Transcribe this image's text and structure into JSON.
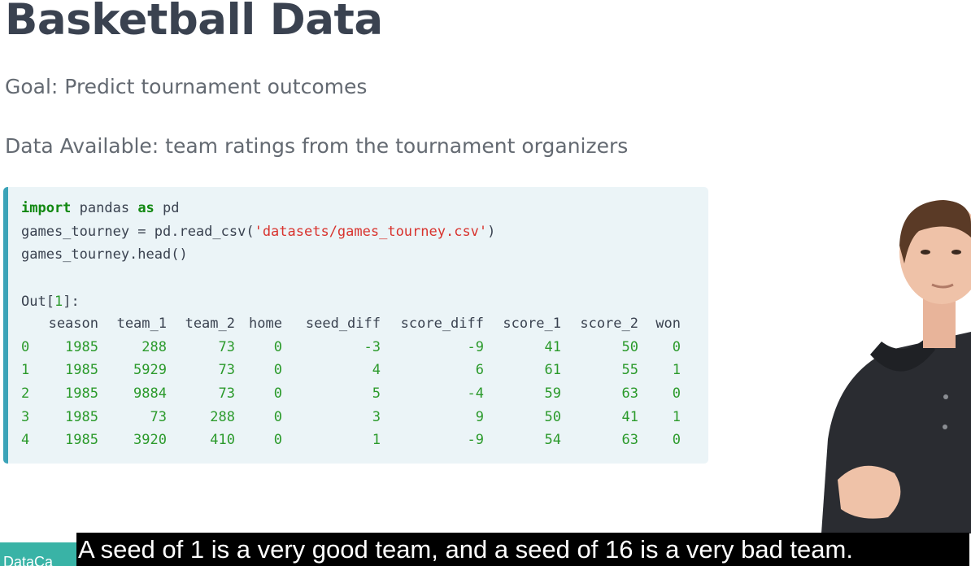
{
  "slide": {
    "title": "Basketball Data",
    "goal": "Goal: Predict tournament outcomes",
    "data_available": "Data Available: team ratings from the tournament organizers"
  },
  "code": {
    "kw_import": "import",
    "mod": " pandas ",
    "kw_as": "as",
    "alias": " pd",
    "line2_pre": "games_tourney = pd.read_csv(",
    "line2_str": "'datasets/games_tourney.csv'",
    "line2_post": ")",
    "line3": "games_tourney.head()",
    "out_pre": "Out[",
    "out_num": "1",
    "out_post": "]:"
  },
  "table": {
    "columns": [
      "",
      "season",
      "team_1",
      "team_2",
      "home",
      "seed_diff",
      "score_diff",
      "score_1",
      "score_2",
      "won"
    ],
    "rows": [
      [
        "0",
        "1985",
        "288",
        "73",
        "0",
        "-3",
        "-9",
        "41",
        "50",
        "0"
      ],
      [
        "1",
        "1985",
        "5929",
        "73",
        "0",
        "4",
        "6",
        "61",
        "55",
        "1"
      ],
      [
        "2",
        "1985",
        "9884",
        "73",
        "0",
        "5",
        "-4",
        "59",
        "63",
        "0"
      ],
      [
        "3",
        "1985",
        "73",
        "288",
        "0",
        "3",
        "9",
        "50",
        "41",
        "1"
      ],
      [
        "4",
        "1985",
        "3920",
        "410",
        "0",
        "1",
        "-9",
        "54",
        "63",
        "0"
      ]
    ]
  },
  "caption": "A seed of 1 is a very good team, and a seed of 16 is a very bad team.",
  "brand": "DataCa",
  "colors": {
    "accent": "#3ba3b8",
    "keyword": "#118811",
    "string": "#d8332e",
    "number": "#2b9a2b",
    "brand": "#39b3a6"
  },
  "icons": {
    "presenter": "presenter-video",
    "brand": "datacamp-logo-icon"
  }
}
